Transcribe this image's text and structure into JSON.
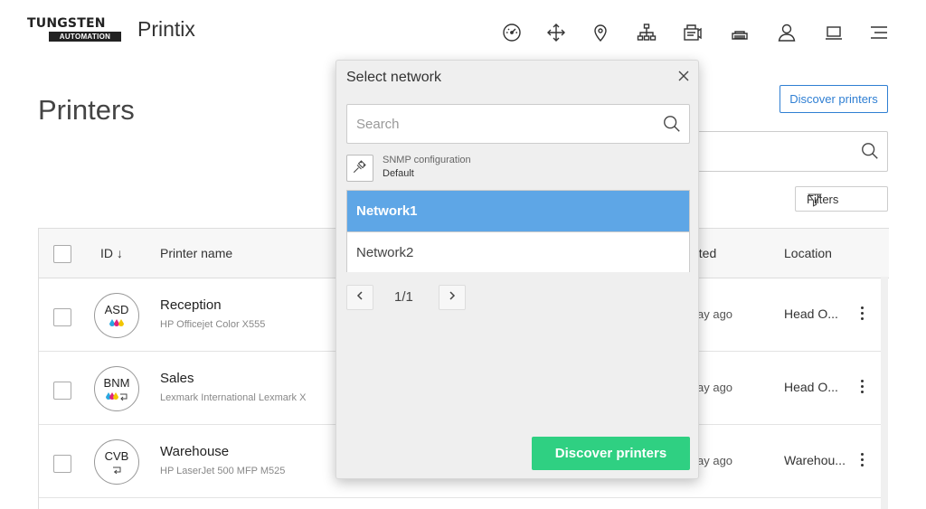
{
  "header": {
    "logo_top": "TUNGSTEN",
    "logo_bottom": "AUTOMATION",
    "brand": "Printix",
    "nav_icons": [
      "dashboard-icon",
      "move-icon",
      "location-pin-icon",
      "network-tree-icon",
      "printer-queue-icon",
      "printer-icon",
      "user-icon",
      "laptop-icon",
      "menu-icon"
    ]
  },
  "page": {
    "title": "Printers",
    "discover_button": "Discover printers",
    "filters_button": "Filters"
  },
  "table": {
    "columns": {
      "id": "ID ↓",
      "name": "Printer name",
      "created": "ated",
      "location": "Location"
    },
    "rows": [
      {
        "code": "ASD",
        "mini": "💧💧",
        "name": "Reception",
        "model": "HP Officejet Color X555",
        "created": "ay ago",
        "location": "Head O..."
      },
      {
        "code": "BNM",
        "mini": "💧💧 ⮎",
        "name": "Sales",
        "model": "Lexmark International Lexmark X",
        "created": "ay ago",
        "location": "Head O..."
      },
      {
        "code": "CVB",
        "mini": "⮎",
        "name": "Warehouse",
        "model": "HP LaserJet 500 MFP M525",
        "created": "ay ago",
        "location": "Warehou..."
      }
    ]
  },
  "modal": {
    "title": "Select network",
    "search_placeholder": "Search",
    "snmp_label": "SNMP configuration",
    "snmp_value": "Default",
    "networks": [
      {
        "name": "Network1",
        "selected": true
      },
      {
        "name": "Network2",
        "selected": false
      }
    ],
    "pager": "1/1",
    "discover_button": "Discover printers"
  },
  "colors": {
    "accent_blue": "#2f7fd3",
    "selected_row": "#5ea6e6",
    "primary_green": "#2fd082"
  }
}
